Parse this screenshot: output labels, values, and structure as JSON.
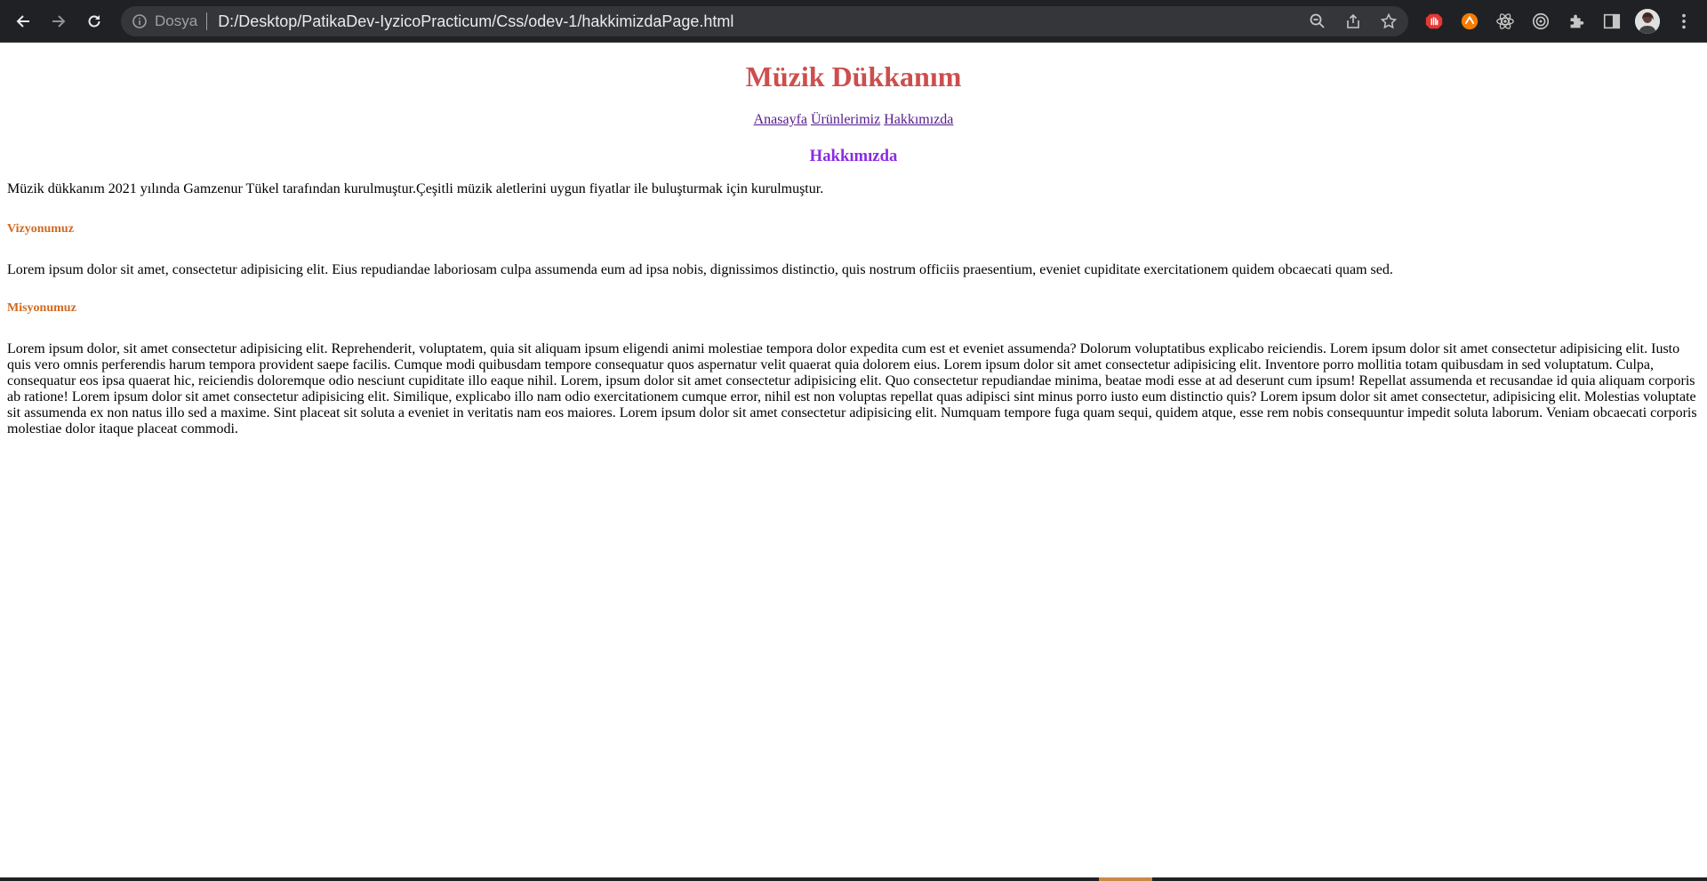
{
  "browser": {
    "scheme_label": "Dosya",
    "url": "D:/Desktop/PatikaDev-IyzicoPracticum/Css/odev-1/hakkimizdaPage.html",
    "icons": {
      "back": "back-arrow-icon",
      "forward": "forward-arrow-icon",
      "reload": "reload-icon",
      "info": "info-icon",
      "zoom": "zoom-icon",
      "share": "share-icon",
      "bookmark": "star-icon",
      "extensions": [
        "red-hand-extension-icon",
        "orange-extension-icon",
        "react-devtools-icon",
        "target-extension-icon",
        "puzzle-extensions-icon",
        "side-panel-icon",
        "profile-avatar",
        "menu-kebab-icon"
      ]
    }
  },
  "page": {
    "site_title": "Müzik Dükkanım",
    "nav": [
      "Anasayfa",
      "Ürünlerimiz",
      "Hakkımızda"
    ],
    "section_title": "Hakkımızda",
    "intro": "Müzik dükkanım 2021 yılında Gamzenur Tükel tarafından kurulmuştur.Çeşitli müzik aletlerini uygun fiyatlar ile buluşturmak için kurulmuştur.",
    "vision_heading": "Vizyonumuz",
    "vision_text": "Lorem ipsum dolor sit amet, consectetur adipisicing elit. Eius repudiandae laboriosam culpa assumenda eum ad ipsa nobis, dignissimos distinctio, quis nostrum officiis praesentium, eveniet cupiditate exercitationem quidem obcaecati quam sed.",
    "mission_heading": "Misyonumuz",
    "mission_text": "Lorem ipsum dolor, sit amet consectetur adipisicing elit. Reprehenderit, voluptatem, quia sit aliquam ipsum eligendi animi molestiae tempora dolor expedita cum est et eveniet assumenda? Dolorum voluptatibus explicabo reiciendis. Lorem ipsum dolor sit amet consectetur adipisicing elit. Iusto quis vero omnis perferendis harum tempora provident saepe facilis. Cumque modi quibusdam tempore consequatur quos aspernatur velit quaerat quia dolorem eius. Lorem ipsum dolor sit amet consectetur adipisicing elit. Inventore porro mollitia totam quibusdam in sed voluptatum. Culpa, consequatur eos ipsa quaerat hic, reiciendis doloremque odio nesciunt cupiditate illo eaque nihil. Lorem, ipsum dolor sit amet consectetur adipisicing elit. Quo consectetur repudiandae minima, beatae modi esse at ad deserunt cum ipsum! Repellat assumenda et recusandae id quia aliquam corporis ab ratione! Lorem ipsum dolor sit amet consectetur adipisicing elit. Similique, explicabo illo nam odio exercitationem cumque error, nihil est non voluptas repellat quas adipisci sint minus porro iusto eum distinctio quis? Lorem ipsum dolor sit amet consectetur, adipisicing elit. Molestias voluptate sit assumenda ex non natus illo sed a maxime. Sint placeat sit soluta a eveniet in veritatis nam eos maiores. Lorem ipsum dolor sit amet consectetur adipisicing elit. Numquam tempore fuga quam sequi, quidem atque, esse rem nobis consequuntur impedit soluta laborum. Veniam obcaecati corporis molestiae dolor itaque placeat commodi."
  },
  "colors": {
    "chrome_bg": "#202124",
    "omnibox_bg": "#35363a",
    "site_title": "#cd4e4e",
    "section_title": "#8a2be2",
    "subheading": "#d2691e",
    "link_visited": "#551a8b"
  }
}
